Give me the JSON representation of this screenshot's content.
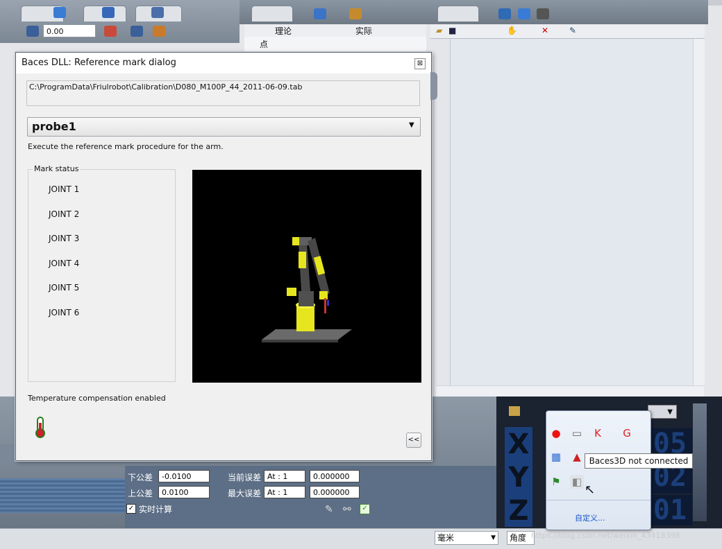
{
  "toolbar": {
    "value": "0.00"
  },
  "tree": {
    "col_theory": "理论",
    "col_actual": "实际",
    "item_point": "点"
  },
  "dialog": {
    "title": "Baces DLL: Reference mark dialog",
    "close_glyph": "⊠",
    "path": "C:\\ProgramData\\Friulrobot\\Calibration\\D080_M100P_44_2011-06-09.tab",
    "probe": "probe1",
    "instruction": "Execute the reference mark procedure for the arm.",
    "mark_status_label": "Mark status",
    "joints": [
      "JOINT 1",
      "JOINT 2",
      "JOINT 3",
      "JOINT 4",
      "JOINT 5",
      "JOINT 6"
    ],
    "temp_comp": "Temperature compensation enabled",
    "collapse_label": "<<"
  },
  "tolerance": {
    "lower_label": "下公差",
    "lower_value": "-0.0100",
    "upper_label": "上公差",
    "upper_value": "0.0100",
    "current_err_label": "当前误差",
    "max_err_label": "最大误差",
    "at_current": "At : 1",
    "at_max": "At : 1",
    "current_err_value": "0.000000",
    "max_err_value": "0.000000",
    "realtime_label": "实时计算"
  },
  "dro": {
    "x_letter": "X",
    "y_letter": "Y",
    "z_letter": "Z",
    "x_digits": "05",
    "y_digits": "02",
    "z_digits": "01"
  },
  "tray": {
    "tooltip": "Baces3D not connected",
    "customize": "自定义..."
  },
  "statusbar": {
    "unit": "毫米",
    "angle": "角度"
  },
  "watermark": "https://blog.csdn.net/weixin_43418398"
}
